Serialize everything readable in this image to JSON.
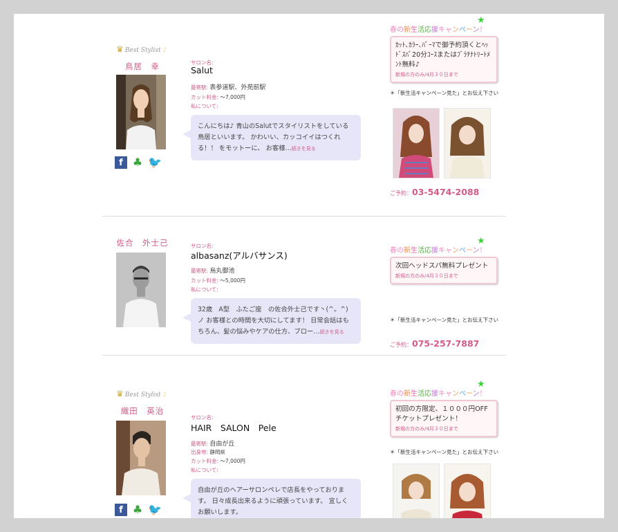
{
  "campaign": {
    "title_chars": [
      {
        "c": "春",
        "col": "#f08ac0"
      },
      {
        "c": "の",
        "col": "#f08ac0"
      },
      {
        "c": "新",
        "col": "#f08a40"
      },
      {
        "c": "生",
        "col": "#e06aa8"
      },
      {
        "c": "活",
        "col": "#60b050"
      },
      {
        "c": "応",
        "col": "#60b050"
      },
      {
        "c": "援",
        "col": "#c07ad0"
      },
      {
        "c": "キ",
        "col": "#f08ac0"
      },
      {
        "c": "ャ",
        "col": "#f08ac0"
      },
      {
        "c": "ン",
        "col": "#f0a060"
      },
      {
        "c": "ペ",
        "col": "#6aaae0"
      },
      {
        "c": "ー",
        "col": "#f0a060"
      },
      {
        "c": "ン",
        "col": "#c07ad0"
      },
      {
        "c": "！",
        "col": "#f08ac0"
      }
    ],
    "star": "★",
    "note": "＊「新生活キャンペーン見た」とお伝え下さい",
    "sub": "新規の方のみ/4月３０日まで",
    "phone_label": "ご予約："
  },
  "labels": {
    "salon": "サロン名:",
    "station": "最寄駅:",
    "cut": "カット料金:",
    "origin": "出身地:",
    "about": "私について:",
    "best": "Best Stylist",
    "best_tail": "♪",
    "crown": "♛",
    "facebook": "f",
    "clover": "♣",
    "twitter": "🐦"
  },
  "stylists": [
    {
      "name": "鳥居　幸",
      "salon": "Salut",
      "station": "表参道駅、外苑前駅",
      "cut": "～7,000円",
      "bio": "こんにちは♪ 青山のSalutでスタイリストをしている鳥居といいます。 かわいい、カッコイイはつくれる！！ をモットーに、 お客様…",
      "more": "続きを見る",
      "campaign_text": "ｶｯﾄ､ｶﾗｰ､ﾊﾟｰﾏで御予約頂くとﾍｯﾄﾞｽﾊﾟ20分ｺｰｽまたはﾌﾞﾗﾁﾅﾄﾘｰﾄﾒﾝﾄ無料♪",
      "phone": "03-5474-2088"
    },
    {
      "name": "佐合　外士己",
      "salon": "albasanz(アルバサンス)",
      "station": "烏丸御池",
      "cut": "～5,000円",
      "bio": "32歳　A型　ふたご座　の佐合外士己です丶(^。^)ノ お客様との時間を大切にしてます！ 日常会話はもちろん、髪の悩みやケアの仕方、ブロー…",
      "more": "続きを見る",
      "campaign_text": "次回ヘッドスパ無料プレゼント",
      "phone": "075-257-7887"
    },
    {
      "name": "織田　英治",
      "salon": "HAIR　SALON　Pele",
      "station": "自由が丘",
      "origin": "静岡県",
      "cut": "～7,000円",
      "bio": "自由が丘のヘアーサロンペレで店長をやっております。 日々成長出来るように頑張っています。 宜しくお願いします。",
      "campaign_text": "初回の方限定、１０００円OFFチケットプレゼント！"
    }
  ]
}
